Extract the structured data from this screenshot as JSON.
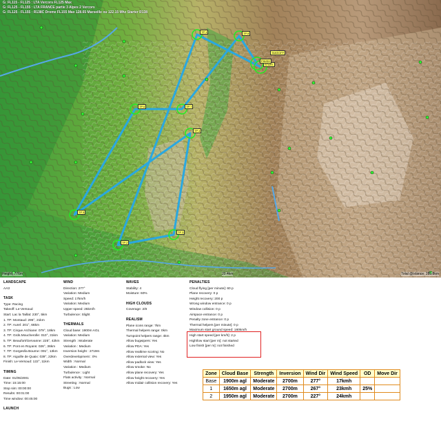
{
  "map": {
    "airspace_lines": [
      "G: FL115 - FL125 : LTA Vercors FL125 Max",
      "G: FL125 - FL155 : LTA FRANCE partie 3 Alpes 2 Vercors",
      "G: FL125 - FL155 : R138C Drome FL155 Max 128.65 Marseille ou 122.15 Mhz Starter R138"
    ],
    "scale_left": "Height) 776m",
    "scale_mid": "20.4km",
    "scale_right": "Total @istance: 285.8km",
    "turnpoints": [
      "TP 1",
      "TP 2",
      "TP 3",
      "TP 4",
      "TP 5",
      "TP 6",
      "TP 7",
      "TP 8",
      "TAKEOFF",
      "START",
      "FINISH"
    ],
    "colors": {
      "route": "#2aa8e0",
      "zone": "#22ee22",
      "label": "#ffff66"
    }
  },
  "info": {
    "landscape": {
      "title": "LANDSCAPE",
      "value": "AA3"
    },
    "task": {
      "title": "TASK",
      "lines": [
        "Type: Racing",
        "Takeoff: Le-Versoud",
        "Start: Lac la Taillat: 230°, 5km",
        "1. TP: Montaud: 295°, 21km",
        "2. TP: Aurel: 201°, 66km",
        "3. TP: Cirque Archiane: 079°, 18km",
        "4. TP: Grds.Moucherolle: 010°, 31km",
        "5. TP: Beaufort/Gervanne: 225°, 42km",
        "6. TP: Pont en Royans: 026°, 36km",
        "7. TP: Gorges/la Bourne: 091°, 13km",
        "8. TP: Aiguille de Quaix: 039°, 22km",
        "Finish: Le-Versoud: 122°, 11km"
      ]
    },
    "timing": {
      "title": "TIMING",
      "lines": [
        "Date: 01/05/2001",
        "Time: 15:15:00",
        "Stop sim: 00:00:00",
        "Results: 00:01:00",
        "Time window: 00:45:00"
      ]
    },
    "launch": {
      "title": "LAUNCH"
    },
    "wind": {
      "title": "WIND",
      "lines": [
        "Direction: 277°",
        "Variation: Medium",
        "Speed: 17km/h",
        "Variation: Medium",
        "Upper speed: 25km/h",
        "Turbulence: Slight"
      ]
    },
    "thermals": {
      "title": "THERMALS",
      "lines": [
        "Cloud base: 1900m AGL",
        "Variation: Medium",
        "Strength : Moderate",
        "Variation : Medium",
        "Inversion height : 2719m",
        "Overdevelopment : 0%",
        "Width : Normal",
        "Variation : Medium",
        "Turbulence : Light",
        "Flats activity : Normal",
        "Streeting : Normal",
        "Bugs : Low"
      ]
    },
    "waves": {
      "title": "WAVES",
      "lines": [
        "Stability: 4",
        "Moisture: 60%"
      ]
    },
    "high_clouds": {
      "title": "HIGH CLOUDS",
      "lines": [
        "Coverage: 2/8"
      ]
    },
    "realism": {
      "title": "REALISM",
      "lines": [
        "Plane icons range: 7km",
        "Thermal helpers range: 0km",
        "Turnpoint helpers range: 4km",
        "Allow bugwipers: Yes",
        "Allow PDA: Yes",
        "Allow realtime scoring: No",
        "Allow external view: Yes",
        "Allow padlock view: Yes",
        "Allow smoke: No",
        "Allow plane recovery: Yes",
        "Allow height recovery: Yes",
        "Allow midair collision recovery: Yes"
      ]
    },
    "penalties": {
      "title": "PENALTIES",
      "lines": [
        "Cloud flying [per minute]: 60 p",
        "Plane recovery: 0 p",
        "Height recovery: 200 p",
        "Wrong window entrance: 0 p",
        "Window collision: 0 p",
        "Airspace entrance: 0 p",
        "Penalty zone entrance: 0 p",
        "Thermal helpers [per minute]: 0 p"
      ],
      "boxed_lines": [
        "Maximum start ground speed: 180km/h",
        "High start speed [per km/h]: 2 p",
        "High/low start [per m]: not started",
        "Low finish [per m]: not finished"
      ]
    }
  },
  "weather_table": {
    "headers": [
      "Zone",
      "Cloud Base",
      "Strength",
      "Inversion",
      "Wind Dir",
      "Wind Speed",
      "OD",
      "Move Dir"
    ],
    "rows": [
      [
        "Base",
        "1900m agl",
        "Moderate",
        "2700m",
        "277°",
        "17kmh",
        "",
        ""
      ],
      [
        "1",
        "1650m agl",
        "Moderate",
        "2700m",
        "267°",
        "23kmh",
        "25%",
        ""
      ],
      [
        "2",
        "1950m agl",
        "Moderate",
        "2700m",
        "227°",
        "24kmh",
        "",
        ""
      ]
    ]
  }
}
